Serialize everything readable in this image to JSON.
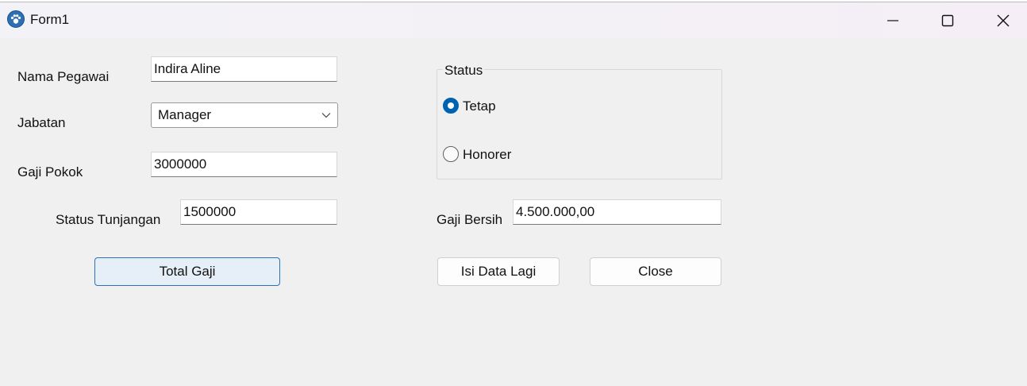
{
  "window": {
    "title": "Form1",
    "icon": "paw-app-icon",
    "controls": [
      "minimize-icon",
      "maximize-icon",
      "close-icon"
    ]
  },
  "form": {
    "nama_pegawai_label": "Nama Pegawai",
    "nama_pegawai_value": "Indira Aline",
    "jabatan_label": "Jabatan",
    "jabatan_value": "Manager",
    "gaji_pokok_label": "Gaji Pokok",
    "gaji_pokok_value": "3000000",
    "status_tunjangan_label": "Status Tunjangan",
    "status_tunjangan_value": "1500000",
    "gaji_bersih_label": "Gaji Bersih",
    "gaji_bersih_value": "4.500.000,00"
  },
  "status_group": {
    "title": "Status",
    "options": [
      {
        "label": "Tetap",
        "checked": true
      },
      {
        "label": "Honorer",
        "checked": false
      }
    ]
  },
  "buttons": {
    "total_gaji": "Total Gaji",
    "isi_data_lagi": "Isi Data Lagi",
    "close": "Close"
  },
  "colors": {
    "accent": "#0063b1",
    "window_bg": "#f0f0f0"
  }
}
